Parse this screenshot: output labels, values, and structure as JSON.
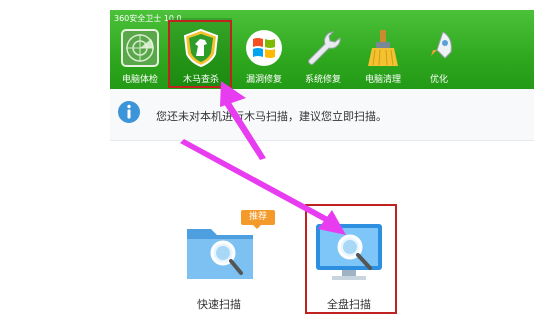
{
  "app": {
    "title": "360安全卫士 10.0"
  },
  "toolbar": {
    "tabs": [
      {
        "label": "电脑体检",
        "icon": "radar-icon"
      },
      {
        "label": "木马查杀",
        "icon": "horse-shield-icon"
      },
      {
        "label": "漏洞修复",
        "icon": "windows-logo-icon"
      },
      {
        "label": "系统修复",
        "icon": "wrench-icon"
      },
      {
        "label": "电脑清理",
        "icon": "broom-icon"
      },
      {
        "label": "优化",
        "icon": "rocket-icon"
      }
    ]
  },
  "info": {
    "message": "您还未对本机进行木马扫描，建议您立即扫描。"
  },
  "scan": {
    "quick_label": "快速扫描",
    "quick_badge": "推荐",
    "full_label": "全盘扫描"
  },
  "colors": {
    "header_green": "#2fa81f",
    "highlight_red": "#c0221f",
    "arrow_magenta": "#e83cf0",
    "badge_orange": "#f39a2a",
    "info_blue": "#3c95d8"
  }
}
